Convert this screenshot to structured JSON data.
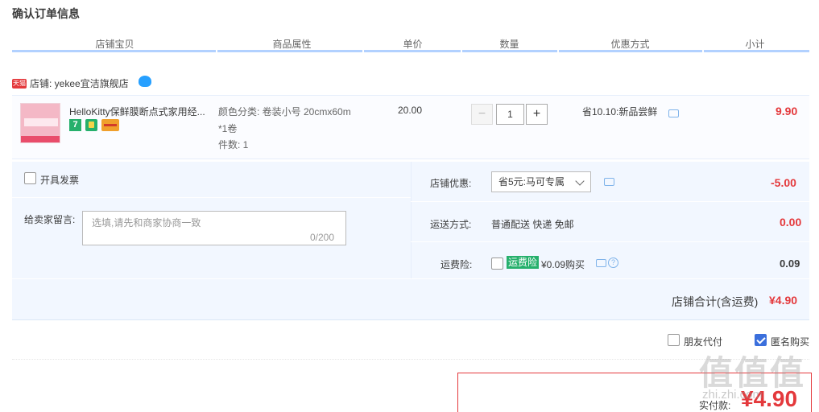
{
  "page": {
    "title": "确认订单信息"
  },
  "table_headers": [
    "店铺宝贝",
    "商品属性",
    "单价",
    "数量",
    "优惠方式",
    "小计"
  ],
  "shop": {
    "badge": "天猫",
    "label": "店铺: yekee宜洁旗舰店"
  },
  "item": {
    "name": "HelloKitty保鲜膜断点式家用经...",
    "attr_color": "颜色分类: 卷装小号 20cmx60m",
    "attr_roll": "*1卷",
    "attr_count": "件数: 1",
    "unit_price": "20.00",
    "qty_minus": "−",
    "quantity": "1",
    "qty_plus": "+",
    "promo": "省10.10:新品尝鲜",
    "subtotal": "9.90",
    "badge_seven": "7"
  },
  "options": {
    "invoice_label": "开具发票",
    "message_label": "给卖家留言:",
    "message_placeholder": "选填,请先和商家协商一致",
    "message_count": "0/200",
    "shop_discount_label": "店铺优惠:",
    "shop_discount_selected": "省5元:马可专属",
    "shop_discount_value": "-5.00",
    "shipping_label": "运送方式:",
    "shipping_value_text": "普通配送 快递 免邮",
    "shipping_value": "0.00",
    "insurance_label": "运费险:",
    "insurance_badge": "运费险",
    "insurance_text": "¥0.09购买",
    "insurance_value": "0.09",
    "help_glyph": "?"
  },
  "totals": {
    "shop_total_label": "店铺合计(含运费)",
    "shop_total_value": "¥4.90",
    "friend_pay_label": "朋友代付",
    "anonymous_label": "匿名购买",
    "pay_label": "实付款:",
    "pay_value": "¥4.90"
  },
  "watermark": {
    "main": "值值值",
    "sub": "zhi.zhi.com"
  },
  "colors": {
    "accent_red": "#e4393c",
    "header_line": "#b2d1ff",
    "options_bg": "#f2f7ff"
  }
}
